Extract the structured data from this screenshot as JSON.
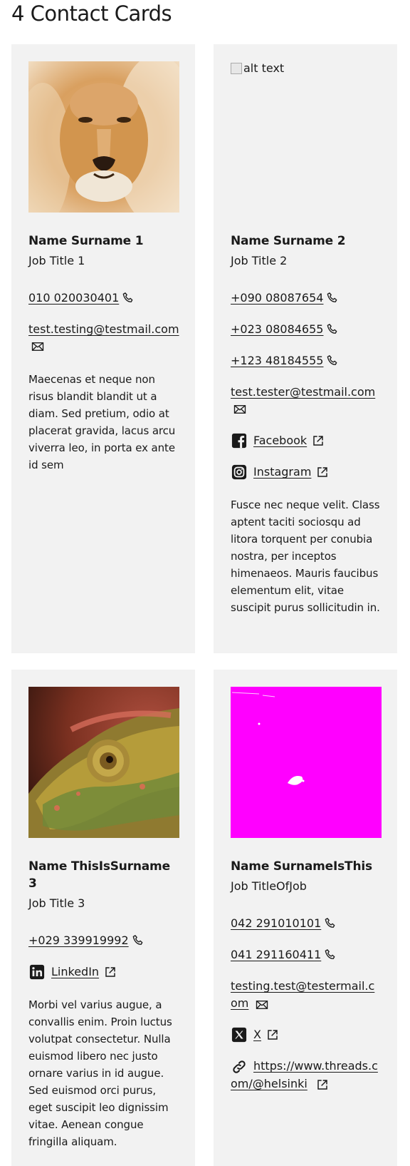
{
  "page": {
    "title": "4 Contact Cards"
  },
  "cards": [
    {
      "image": {
        "type": "lion"
      },
      "name": "Name Surname 1",
      "job": "Job Title 1",
      "phones": [
        "010 020030401"
      ],
      "email": "test.testing@testmail.com",
      "links": [],
      "description": "Maecenas et neque non risus blandit blandit ut a diam. Sed pretium, odio at placerat gravida, lacus arcu viverra leo, in porta ex ante id sem"
    },
    {
      "image": {
        "type": "broken",
        "alt": "alt text"
      },
      "name": "Name Surname 2",
      "job": "Job Title 2",
      "phones": [
        "+090 08087654",
        "+023 08084655",
        "+123 48184555"
      ],
      "email": "test.tester@testmail.com",
      "links": [
        {
          "label": "Facebook",
          "icon": "facebook-icon"
        },
        {
          "label": "Instagram",
          "icon": "instagram-icon"
        }
      ],
      "description": "Fusce nec neque velit. Class aptent taciti sociosqu ad litora torquent per conubia nostra, per inceptos himenaeos. Mauris faucibus elementum elit, vitae suscipit purus sollicitudin in."
    },
    {
      "image": {
        "type": "chameleon"
      },
      "name": "Name ThisIsSurname 3",
      "job": "Job Title 3",
      "phones": [
        "+029 339919992"
      ],
      "email": "",
      "links": [
        {
          "label": "LinkedIn",
          "icon": "linkedin-icon"
        }
      ],
      "description": "Morbi vel varius augue, a convallis enim. Proin luctus volutpat consectetur. Nulla euismod libero nec justo ornare varius in id augue. Sed euismod orci purus, eget suscipit leo dignissim vitae. Aenean congue fringilla aliquam."
    },
    {
      "image": {
        "type": "magenta"
      },
      "name": "Name SurnameIsThis",
      "job": "Job TitleOfJob",
      "phones": [
        "042 291010101",
        "041 291160411"
      ],
      "email": "testing.test@testermail.com",
      "links": [
        {
          "label": "X",
          "icon": "x-icon"
        },
        {
          "label": "https://www.threads.com/@helsinki",
          "icon": "link-icon"
        }
      ],
      "description": ""
    }
  ],
  "colors": {
    "card_bg": "#f2f2f2",
    "text": "#1a1a1a",
    "magenta": "#ff00ff"
  }
}
